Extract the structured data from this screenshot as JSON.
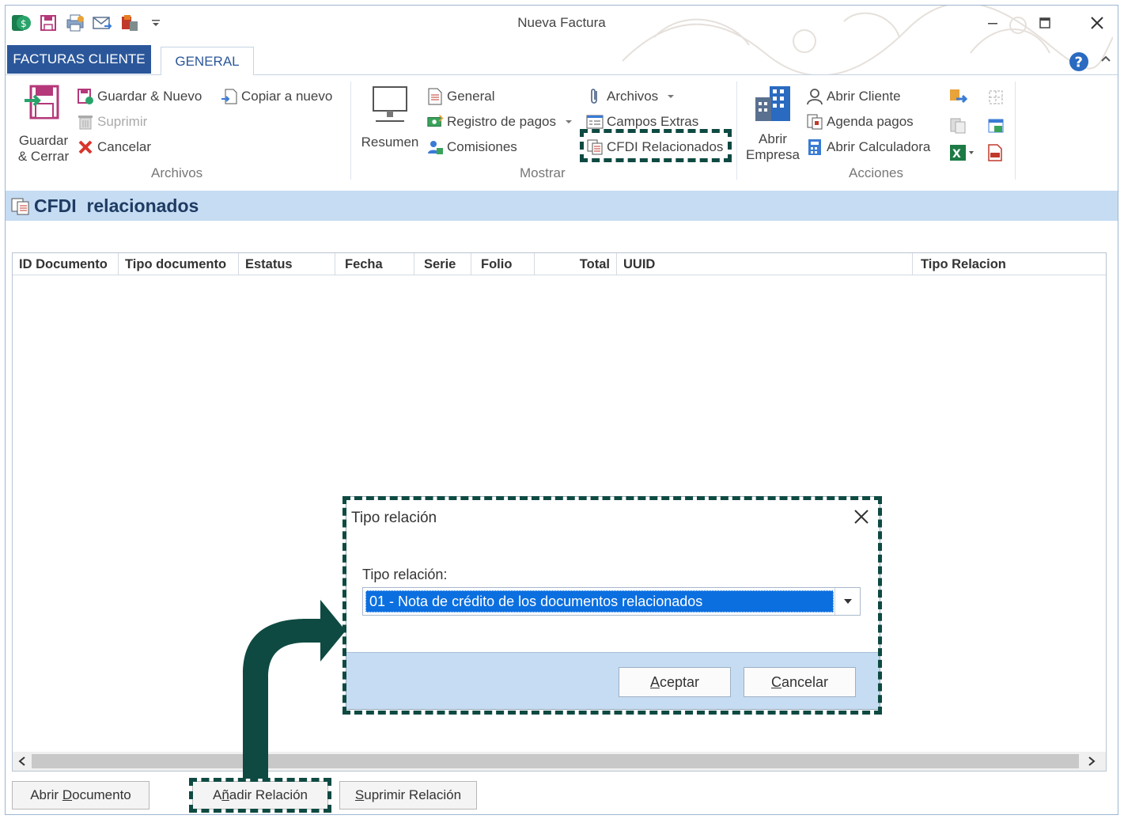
{
  "window": {
    "title": "Nueva Factura"
  },
  "ribbon_tabs": {
    "app_tab": "FACTURAS CLIENTE",
    "general_tab": "GENERAL"
  },
  "archivos_group": {
    "label": "Archivos",
    "guardar_cerrar_line1": "Guardar",
    "guardar_cerrar_line2": "& Cerrar",
    "guardar_nuevo": "Guardar & Nuevo",
    "copiar_nuevo": "Copiar a nuevo",
    "suprimir": "Suprimir",
    "cancelar": "Cancelar"
  },
  "mostrar_group": {
    "label": "Mostrar",
    "resumen": "Resumen",
    "general": "General",
    "registro_pagos": "Registro de pagos",
    "comisiones": "Comisiones",
    "archivos": "Archivos",
    "campos_extras": "Campos Extras",
    "cfdi_relacionados": "CFDI Relacionados"
  },
  "acciones_group": {
    "label": "Acciones",
    "abrir_empresa_line1": "Abrir",
    "abrir_empresa_line2": "Empresa",
    "abrir_cliente": "Abrir Cliente",
    "agenda_pagos": "Agenda pagos",
    "abrir_calculadora": "Abrir Calculadora"
  },
  "section": {
    "title": "CFDI  relacionados"
  },
  "grid": {
    "columns": [
      "ID Documento",
      "Tipo documento",
      "Estatus",
      "Fecha",
      "Serie",
      "Folio",
      "Total",
      "UUID",
      "Tipo Relacion"
    ]
  },
  "bottom_buttons": {
    "abrir_documento_pre": "Abrir ",
    "abrir_documento_u": "D",
    "abrir_documento_post": "ocumento",
    "anadir_relacion_pre": "A",
    "anadir_relacion_u": "ñ",
    "anadir_relacion_post": "adir Relación",
    "suprimir_relacion_u": "S",
    "suprimir_relacion_post": "uprimir Relación"
  },
  "dialog": {
    "title": "Tipo relación",
    "field_label": "Tipo relación:",
    "selected_value": "01 - Nota de crédito de los documentos relacionados",
    "aceptar_u": "A",
    "aceptar_post": "ceptar",
    "cancelar_u": "C",
    "cancelar_post": "ancelar"
  },
  "colors": {
    "accent": "#2b579a",
    "section_bg": "#c5dcf2",
    "selection": "#0b6fe0",
    "annotation": "#0e4a42"
  }
}
